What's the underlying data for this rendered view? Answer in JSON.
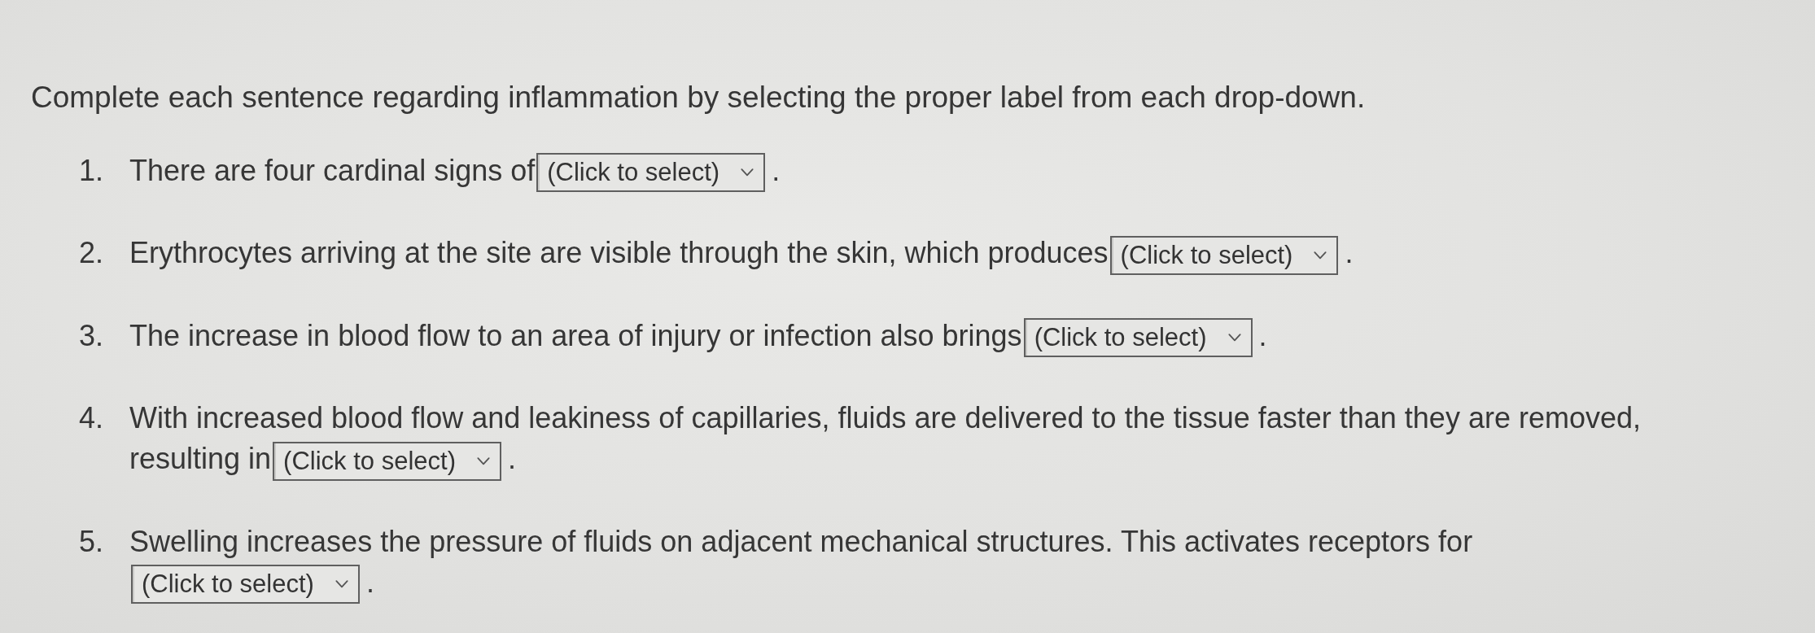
{
  "instruction": "Complete each sentence regarding inflammation by selecting the proper label from each drop-down.",
  "questions": [
    {
      "number": "1.",
      "text_lines": [
        "There are four cardinal signs of"
      ],
      "dropdown": {
        "placeholder": "(Click to select)"
      },
      "text_after": "."
    },
    {
      "number": "2.",
      "text_lines": [
        "Erythrocytes arriving at the site are visible through the skin, which produces"
      ],
      "dropdown": {
        "placeholder": "(Click to select)"
      },
      "text_after": "."
    },
    {
      "number": "3.",
      "text_lines": [
        "The increase in blood flow to an area of injury or infection also brings"
      ],
      "dropdown": {
        "placeholder": "(Click to select)"
      },
      "text_after": "."
    },
    {
      "number": "4.",
      "text_lines": [
        "With increased blood flow and leakiness of capillaries, fluids are delivered to the tissue faster than they are removed,",
        "resulting in"
      ],
      "dropdown": {
        "placeholder": "(Click to select)"
      },
      "text_after": "."
    },
    {
      "number": "5.",
      "text_lines": [
        "Swelling increases the pressure of fluids on adjacent mechanical structures. This activates receptors for"
      ],
      "dropdown": {
        "placeholder": "(Click to select)"
      },
      "text_after": "."
    }
  ]
}
